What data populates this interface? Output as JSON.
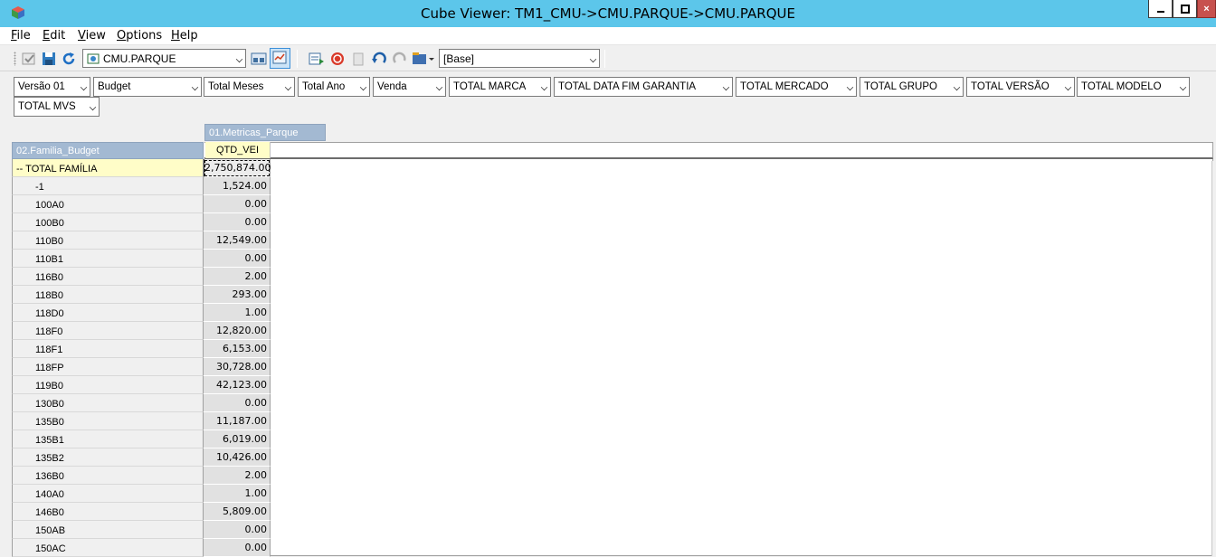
{
  "window": {
    "title": "Cube Viewer: TM1_CMU->CMU.PARQUE->CMU.PARQUE",
    "minimize_icon": "minimize-icon",
    "maximize_icon": "maximize-icon",
    "close_icon": "close-icon"
  },
  "menu": [
    "File",
    "Edit",
    "View",
    "Options",
    "Help"
  ],
  "toolbar": {
    "cube_select": "CMU.PARQUE",
    "subset_select": "[Base]",
    "icons": [
      "checkmark-icon",
      "save-icon",
      "recalculate-icon",
      "cube-browse-icon",
      "view-selected-icon",
      "export-icon",
      "stop-icon",
      "clear-icon",
      "undo-icon",
      "redo-icon",
      "sandbox-icon"
    ]
  },
  "dimension_filters": [
    "Versão 01",
    "Budget",
    "Total Meses",
    "Total Ano",
    "Venda",
    "TOTAL MARCA",
    "TOTAL DATA FIM GARANTIA",
    "TOTAL MERCADO",
    "TOTAL GRUPO",
    "TOTAL VERSÃO",
    "TOTAL MODELO",
    "TOTAL MVS"
  ],
  "grid": {
    "column_dimension": "01.Metricas_Parque",
    "row_dimension": "02.Familia_Budget",
    "column_member": "QTD_VEI",
    "rows": [
      {
        "label": "-- TOTAL FAMÍLIA",
        "value": "2,750,874.00",
        "total": true
      },
      {
        "label": "-1",
        "value": "1,524.00"
      },
      {
        "label": "100A0",
        "value": "0.00"
      },
      {
        "label": "100B0",
        "value": "0.00"
      },
      {
        "label": "110B0",
        "value": "12,549.00"
      },
      {
        "label": "110B1",
        "value": "0.00"
      },
      {
        "label": "116B0",
        "value": "2.00"
      },
      {
        "label": "118B0",
        "value": "293.00"
      },
      {
        "label": "118D0",
        "value": "1.00"
      },
      {
        "label": "118F0",
        "value": "12,820.00"
      },
      {
        "label": "118F1",
        "value": "6,153.00"
      },
      {
        "label": "118FP",
        "value": "30,728.00"
      },
      {
        "label": "119B0",
        "value": "42,123.00"
      },
      {
        "label": "130B0",
        "value": "0.00"
      },
      {
        "label": "135B0",
        "value": "11,187.00"
      },
      {
        "label": "135B1",
        "value": "6,019.00"
      },
      {
        "label": "135B2",
        "value": "10,426.00"
      },
      {
        "label": "136B0",
        "value": "2.00"
      },
      {
        "label": "140A0",
        "value": "1.00"
      },
      {
        "label": "146B0",
        "value": "5,809.00"
      },
      {
        "label": "150AB",
        "value": "0.00"
      },
      {
        "label": "150AC",
        "value": "0.00"
      }
    ]
  }
}
